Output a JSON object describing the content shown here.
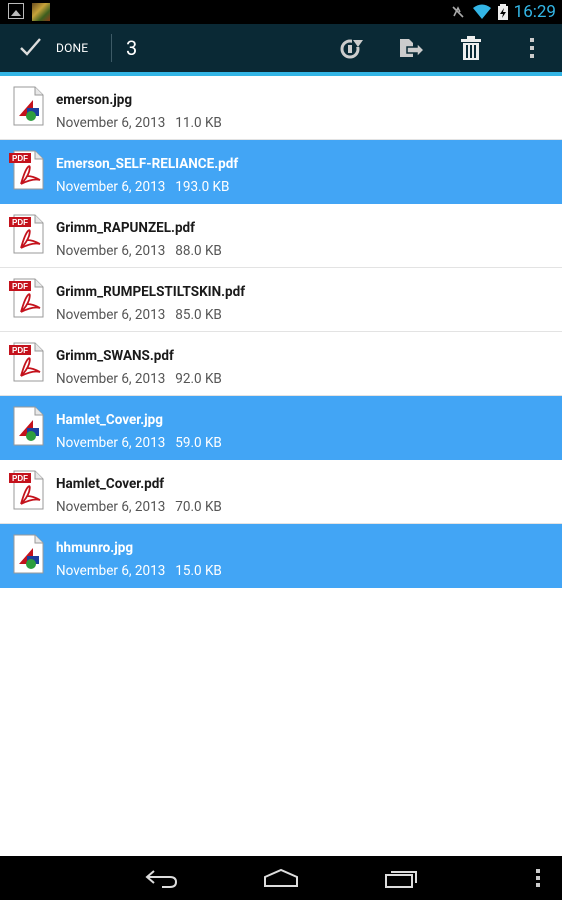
{
  "status_bar": {
    "time": "16:29",
    "icons": [
      "gallery-notification-icon",
      "thumbnail-notification-icon",
      "muted-icon",
      "wifi-icon",
      "battery-charging-icon"
    ]
  },
  "action_bar": {
    "done_label": "DONE",
    "selected_count": "3",
    "actions": [
      "share-icon",
      "move-icon",
      "trash-icon",
      "overflow-menu-icon"
    ]
  },
  "files": [
    {
      "name": "emerson.jpg",
      "date": "November 6, 2013",
      "size": "11.0 KB",
      "type": "image",
      "selected": false
    },
    {
      "name": "Emerson_SELF-RELIANCE.pdf",
      "date": "November 6, 2013",
      "size": "193.0 KB",
      "type": "pdf",
      "selected": true
    },
    {
      "name": "Grimm_RAPUNZEL.pdf",
      "date": "November 6, 2013",
      "size": "88.0 KB",
      "type": "pdf",
      "selected": false
    },
    {
      "name": "Grimm_RUMPELSTILTSKIN.pdf",
      "date": "November 6, 2013",
      "size": "85.0 KB",
      "type": "pdf",
      "selected": false
    },
    {
      "name": "Grimm_SWANS.pdf",
      "date": "November 6, 2013",
      "size": "92.0 KB",
      "type": "pdf",
      "selected": false
    },
    {
      "name": "Hamlet_Cover.jpg",
      "date": "November 6, 2013",
      "size": "59.0 KB",
      "type": "image",
      "selected": true
    },
    {
      "name": "Hamlet_Cover.pdf",
      "date": "November 6, 2013",
      "size": "70.0 KB",
      "type": "pdf",
      "selected": false
    },
    {
      "name": "hhmunro.jpg",
      "date": "November 6, 2013",
      "size": "15.0 KB",
      "type": "image",
      "selected": true
    }
  ],
  "pdf_badge": "PDF",
  "colors": {
    "action_bar": "#0a2935",
    "accent": "#33b5e5",
    "selected_row": "#42a5f5"
  },
  "nav_bar": [
    "back-icon",
    "home-icon",
    "recent-apps-icon",
    "overflow-menu-icon"
  ]
}
